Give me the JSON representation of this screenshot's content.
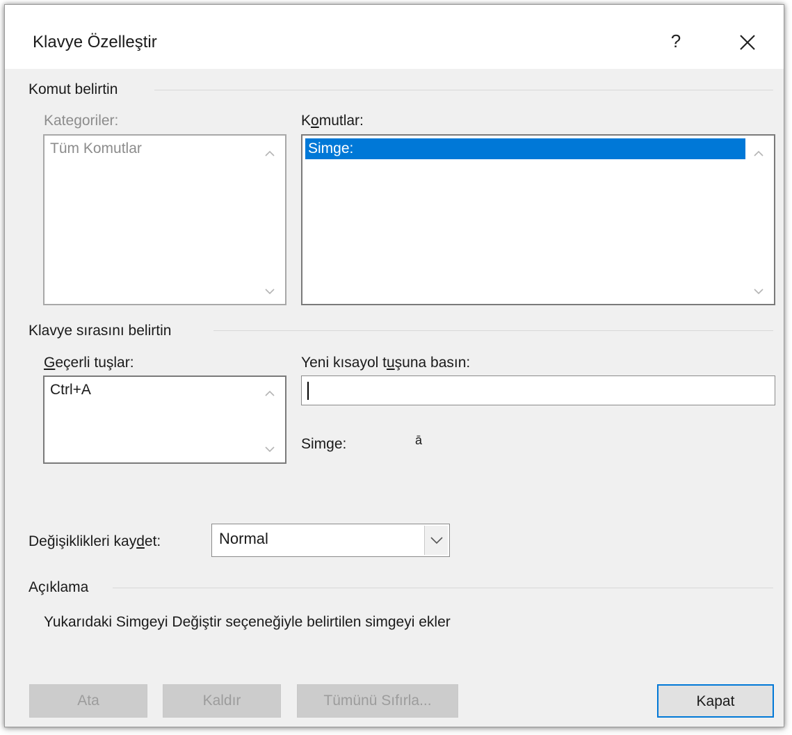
{
  "window": {
    "title": "Klavye Özelleştir",
    "help_label": "?",
    "close_icon": "close-icon"
  },
  "command_section": {
    "title": "Komut belirtin",
    "categories_label": "Kategoriler:",
    "categories_items": [
      "Tüm Komutlar"
    ],
    "commands_label_pre": "K",
    "commands_label_ul": "o",
    "commands_label_post": "mutlar:",
    "commands_items": [
      "Simge:"
    ],
    "selected_color": "#0078d7"
  },
  "keyboard_section": {
    "title": "Klavye sırasını belirtin",
    "current_keys_label_ul": "G",
    "current_keys_label_post": "eçerli tuşlar:",
    "current_keys_items": [
      "Ctrl+A"
    ],
    "new_key_label_pre": "Yeni kısayol t",
    "new_key_label_ul": "u",
    "new_key_label_post": "şuna basın:",
    "new_key_value": "",
    "symbol_label": "Simge:",
    "symbol_value": "ā"
  },
  "save_changes": {
    "label_pre": "Değişiklikleri kay",
    "label_ul": "d",
    "label_post": "et:",
    "selected": "Normal"
  },
  "description": {
    "title": "Açıklama",
    "text": "Yukarıdaki Simgeyi Değiştir seçeneğiyle belirtilen simgeyi ekler"
  },
  "buttons": {
    "assign": "Ata",
    "remove": "Kaldır",
    "reset_all": "Tümünü Sıfırla...",
    "close": "Kapat"
  }
}
